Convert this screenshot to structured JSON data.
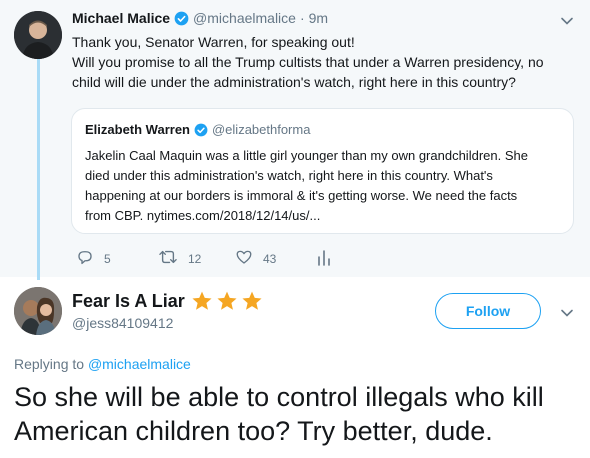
{
  "parent_tweet": {
    "author_name": "Michael Malice",
    "handle": "@michaelmalice",
    "separator": "·",
    "time": "9m",
    "text_lines": [
      "Thank you, Senator Warren, for speaking out!",
      "Will you promise to all the Trump cultists that under a Warren presidency, no",
      "child will die under the administration's watch, right here in this country?"
    ],
    "quoted": {
      "author_name": "Elizabeth Warren",
      "handle": "@elizabethforma",
      "text_lines": [
        "Jakelin Caal Maquin was a little girl younger than my own grandchildren. She",
        "died under this administration's watch, right here in this country. What's",
        "happening at our borders is immoral & it's getting worse. We need the facts",
        "from CBP. nytimes.com/2018/12/14/us/..."
      ]
    },
    "actions": {
      "reply_count": "5",
      "retweet_count": "12",
      "like_count": "43"
    }
  },
  "reply_tweet": {
    "author_name": "Fear Is A Liar",
    "stars": 3,
    "handle": "@jess84109412",
    "follow_label": "Follow",
    "replying_prefix": "Replying to",
    "replying_to": "@michaelmalice",
    "text_lines": [
      "So she will be able to control illegals who kill",
      "American children too? Try better, dude."
    ]
  },
  "colors": {
    "accent": "#1da1f2",
    "thread_line": "#a9dbf6",
    "muted_text": "#657786",
    "star": "#f5a623",
    "parent_background": "#f5f8fa"
  },
  "icons": [
    "verified-badge-icon",
    "chevron-down-icon",
    "reply-icon",
    "retweet-icon",
    "like-icon",
    "analytics-icon",
    "star-icon"
  ]
}
